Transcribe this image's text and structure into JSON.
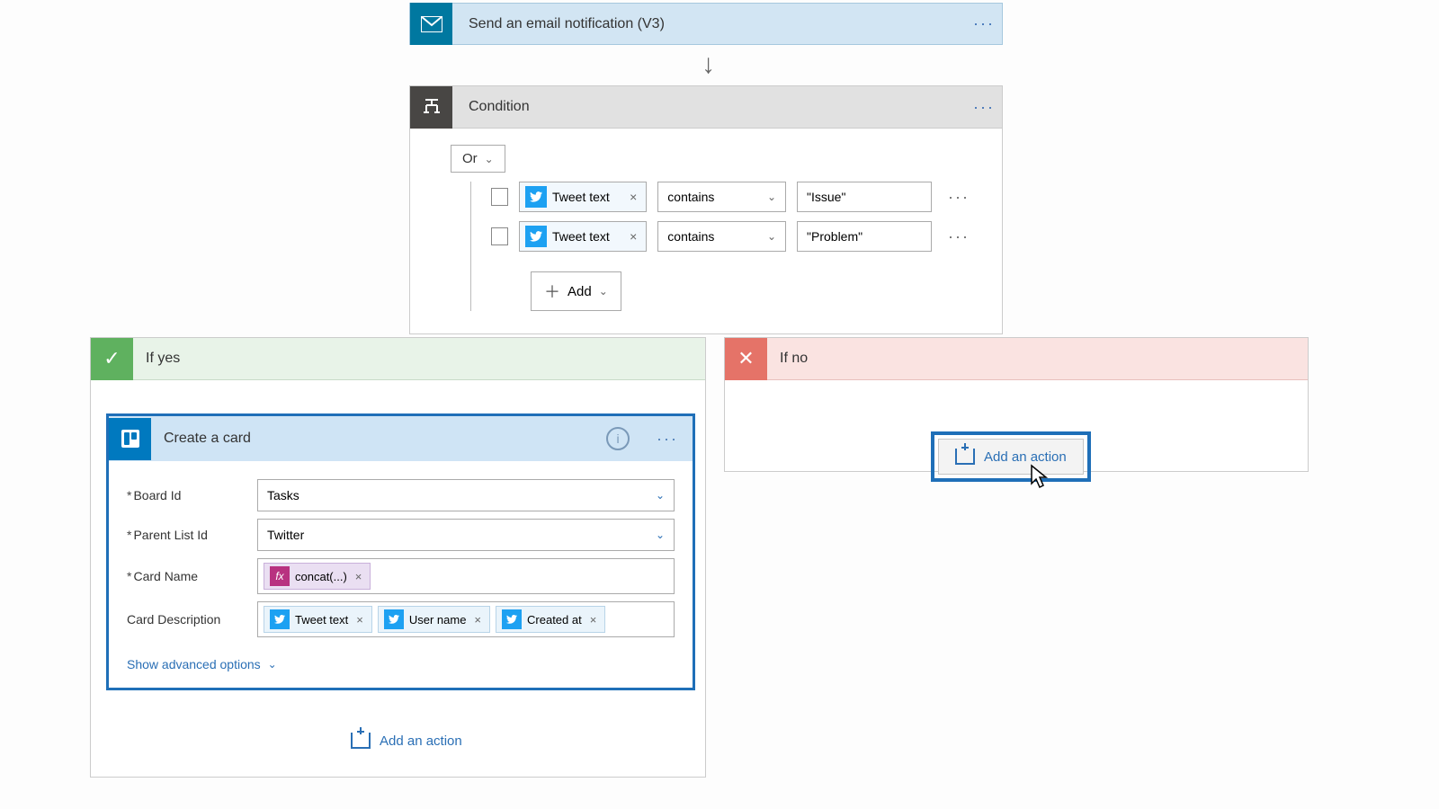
{
  "top_action": {
    "title": "Send an email notification (V3)"
  },
  "condition": {
    "title": "Condition",
    "group_op": "Or",
    "rows": [
      {
        "token": "Tweet text",
        "operator": "contains",
        "value": "\"Issue\""
      },
      {
        "token": "Tweet text",
        "operator": "contains",
        "value": "\"Problem\""
      }
    ],
    "add_label": "Add"
  },
  "branches": {
    "yes_label": "If yes",
    "no_label": "If no",
    "add_action_label": "Add an action"
  },
  "create_card": {
    "title": "Create a card",
    "fields": {
      "board_id_label": "Board Id",
      "board_id_value": "Tasks",
      "parent_list_label": "Parent List Id",
      "parent_list_value": "Twitter",
      "card_name_label": "Card Name",
      "card_name_token": "concat(...)",
      "card_desc_label": "Card Description",
      "desc_tokens": [
        "Tweet text",
        "User name",
        "Created at"
      ]
    },
    "advanced_label": "Show advanced options"
  },
  "colors": {
    "accent": "#1f6fb8",
    "twitter": "#1da1f2",
    "trello": "#0079bf",
    "yes": "#5fb15f",
    "no": "#e57368"
  }
}
